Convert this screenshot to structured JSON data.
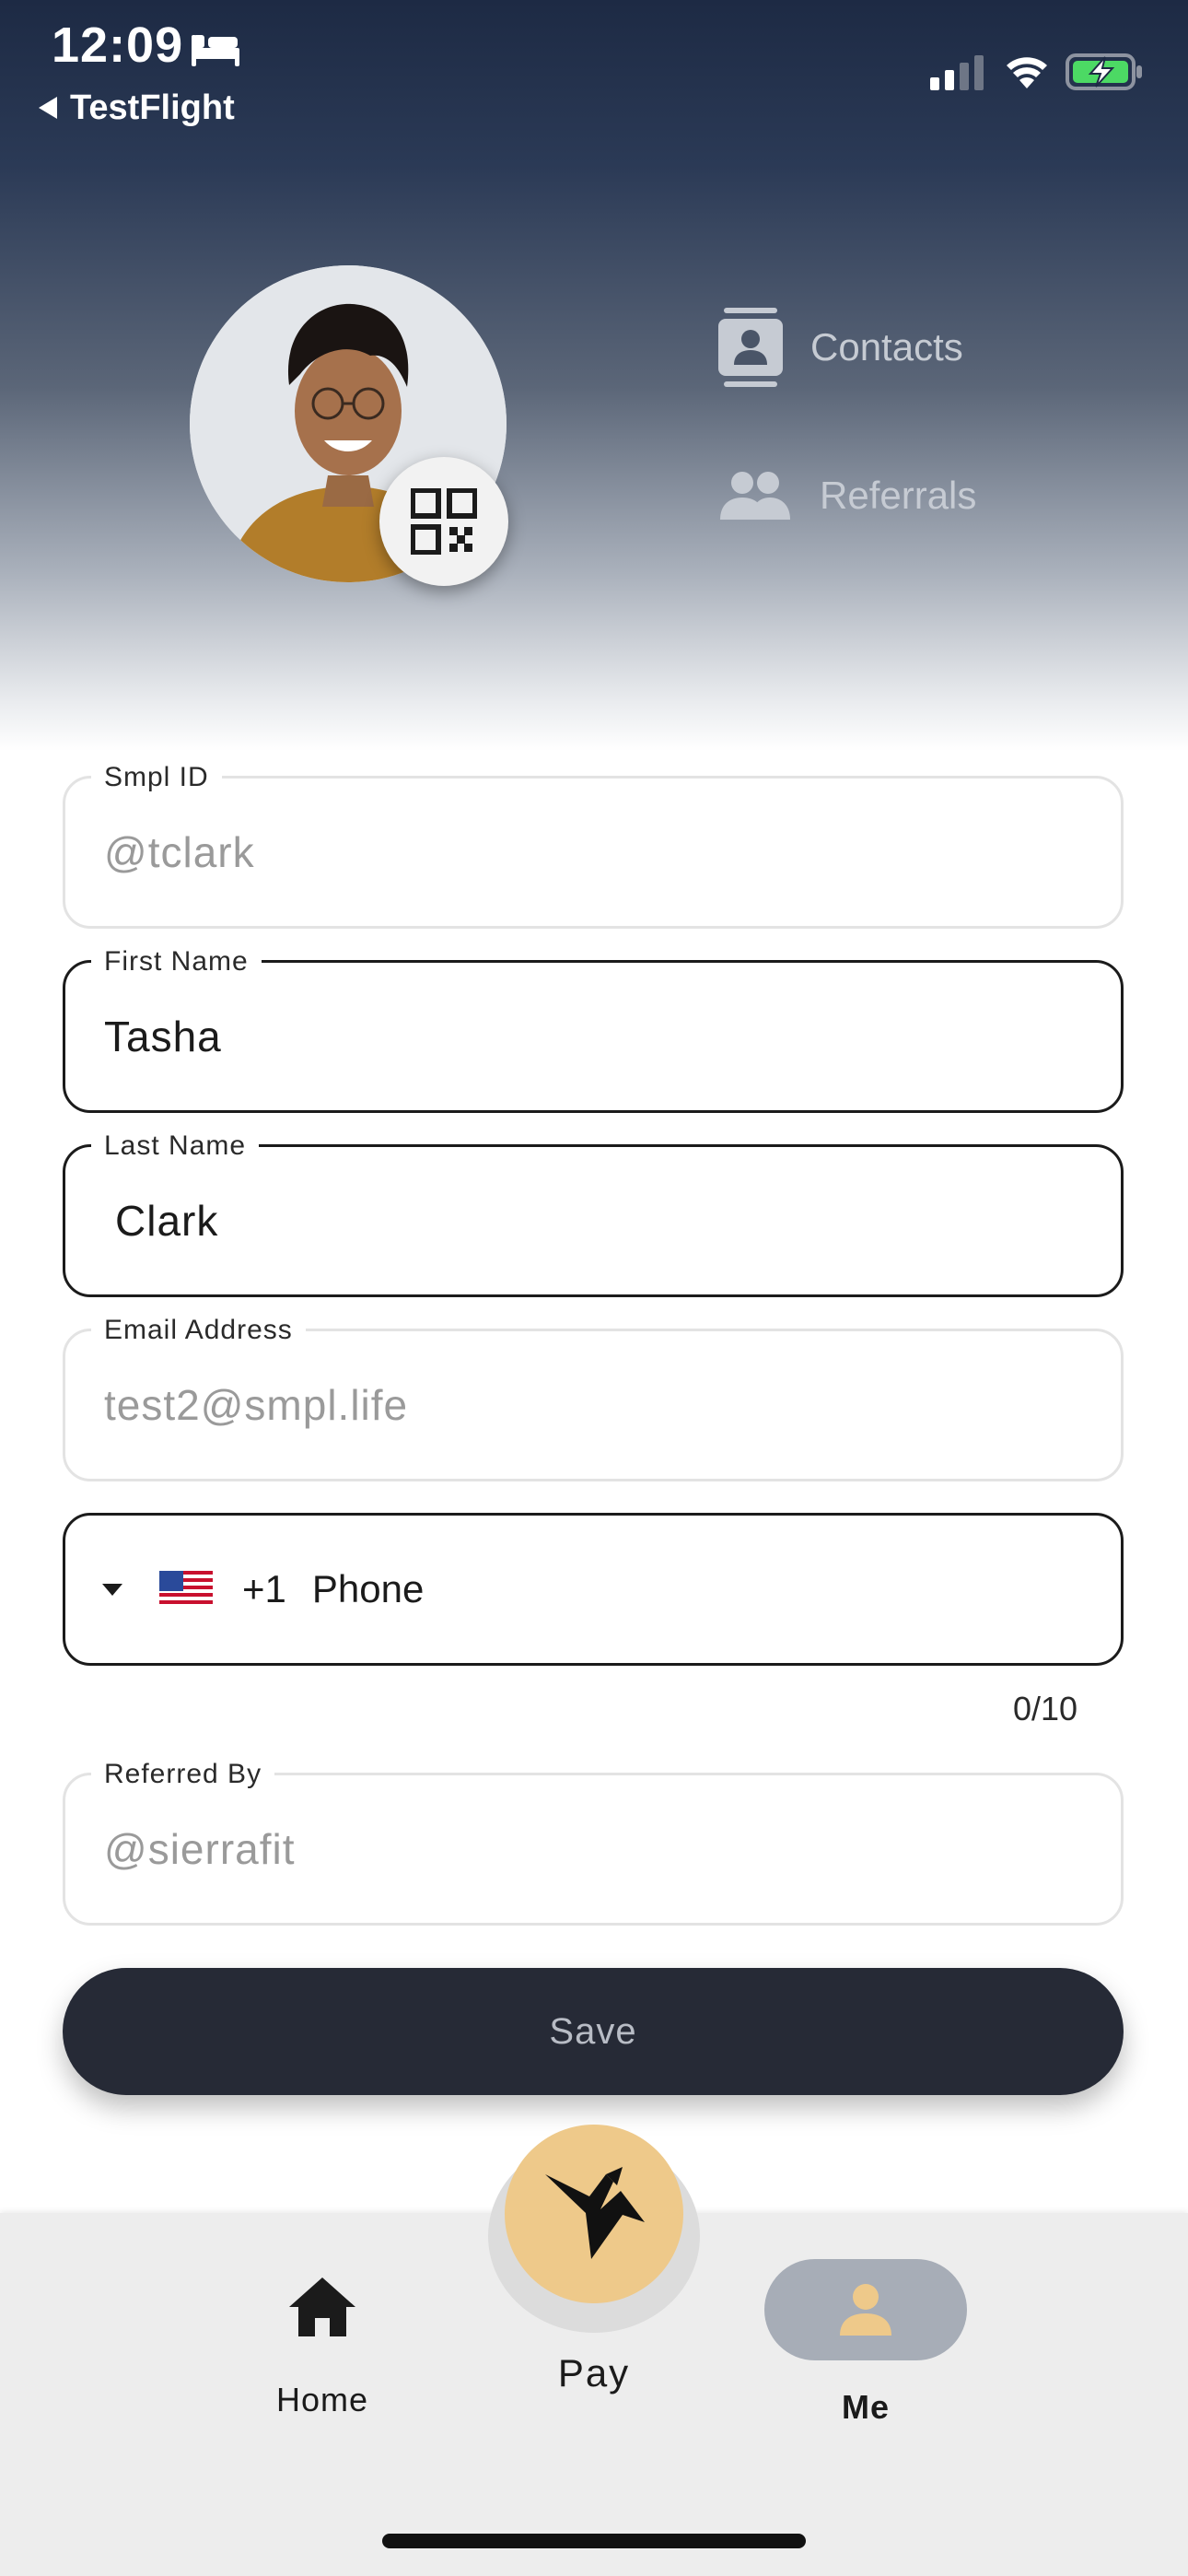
{
  "status_bar": {
    "time": "12:09",
    "back_app": "TestFlight"
  },
  "profile": {
    "avatar_alt": "Tasha Clark",
    "links": {
      "contacts": "Contacts",
      "referrals": "Referrals"
    }
  },
  "form": {
    "smpl_id": {
      "label": "Smpl ID",
      "value": "@tclark"
    },
    "first_name": {
      "label": "First Name",
      "value": "Tasha"
    },
    "last_name": {
      "label": "Last Name",
      "value": "Clark"
    },
    "email": {
      "label": "Email Address",
      "value": "test2@smpl.life"
    },
    "phone": {
      "country_code": "+1",
      "placeholder": "Phone",
      "counter": "0/10"
    },
    "referred_by": {
      "label": "Referred By",
      "value": "@sierrafit"
    },
    "save_label": "Save"
  },
  "nav": {
    "home": "Home",
    "pay": "Pay",
    "me": "Me"
  },
  "colors": {
    "header_top": "#1d2a44",
    "save_bg": "#262a36",
    "pay_gold": "#eec98a",
    "me_pill": "#a7adb7"
  }
}
